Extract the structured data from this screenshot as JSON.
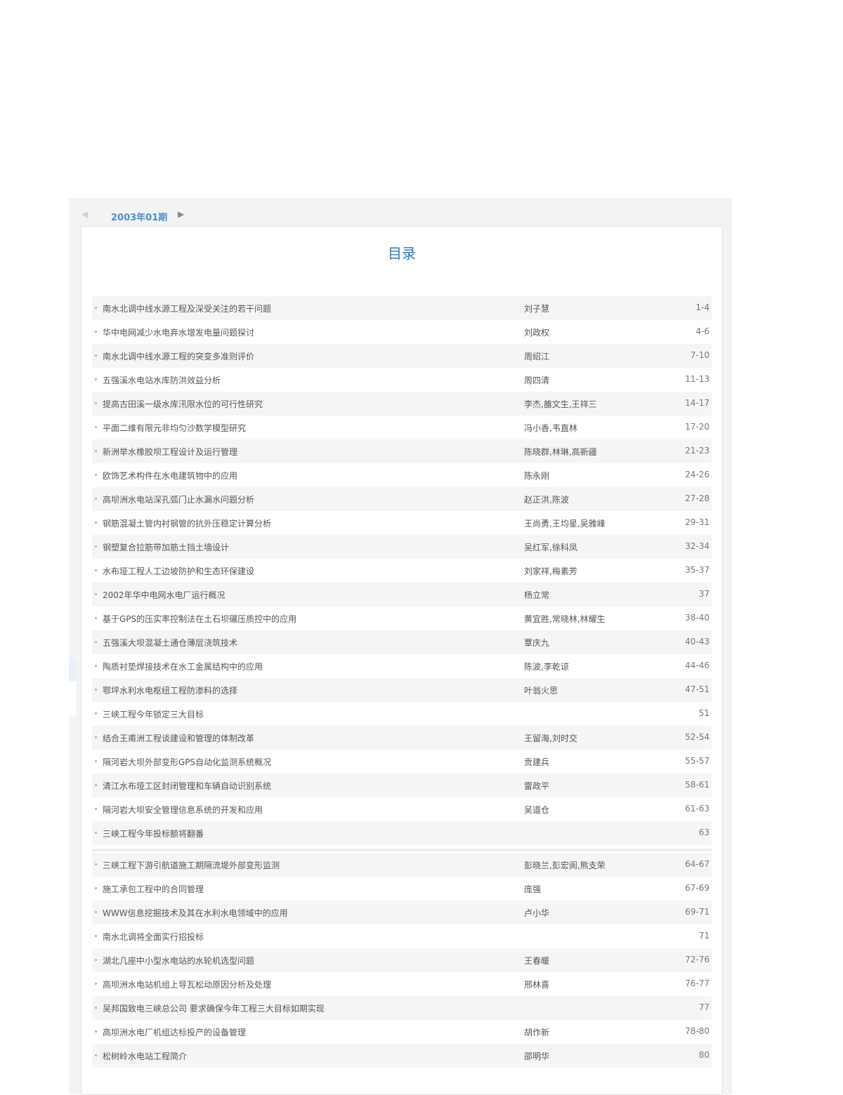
{
  "issue_nav": {
    "prev_icon": "◀",
    "issue_label": "2003年01期",
    "next_icon": "▶"
  },
  "toc": {
    "title": "目录",
    "articles_a": [
      {
        "title": "南水北调中线水源工程及深受关注的若干问题",
        "authors": "刘子慧",
        "pages": "1-4"
      },
      {
        "title": "华中电网减少水电弃水增发电量问题探讨",
        "authors": "刘政权",
        "pages": "4-6"
      },
      {
        "title": "南水北调中线水源工程的突变多准则评价",
        "authors": "周绍江",
        "pages": "7-10"
      },
      {
        "title": "五强溪水电站水库防洪效益分析",
        "authors": "周四清",
        "pages": "11-13"
      },
      {
        "title": "提高古田溪一级水库汛限水位的可行性研究",
        "authors": "李杰,雒文生,王祥三",
        "pages": "14-17"
      },
      {
        "title": "平面二维有限元非均匀沙数学模型研究",
        "authors": "冯小香,韦直林",
        "pages": "17-20"
      },
      {
        "title": "新洲举水橡胶坝工程设计及运行管理",
        "authors": "陈晓群,林琳,高新疆",
        "pages": "21-23"
      },
      {
        "title": "欧饰艺术构件在水电建筑物中的应用",
        "authors": "陈永刚",
        "pages": "24-26"
      },
      {
        "title": "高坝洲水电站深孔弧门止水漏水问题分析",
        "authors": "赵正洪,陈波",
        "pages": "27-28"
      },
      {
        "title": "钢筋混凝土管内衬钢管的抗外压稳定计算分析",
        "authors": "王尚勇,王均星,吴雅峰",
        "pages": "29-31"
      },
      {
        "title": "钢塑复合拉筋带加筋土挡土墙设计",
        "authors": "吴红军,徐科凤",
        "pages": "32-34"
      },
      {
        "title": "水布垭工程人工边坡防护和生态环保建设",
        "authors": "刘家祥,梅素芳",
        "pages": "35-37"
      },
      {
        "title": "2002年华中电网水电厂运行概况",
        "authors": "杨立常",
        "pages": "37"
      },
      {
        "title": "基于GPS的压实率控制法在土石坝碾压质控中的应用",
        "authors": "黄宜胜,常晓林,林耀生",
        "pages": "38-40"
      },
      {
        "title": "五强溪大坝混凝土通仓薄层浇筑技术",
        "authors": "覃庆九",
        "pages": "40-43"
      },
      {
        "title": "陶质衬垫焊接技术在水工金属结构中的应用",
        "authors": "陈波,李乾谅",
        "pages": "44-46"
      },
      {
        "title": "鄂坪水利水电枢纽工程防渗料的选择",
        "authors": "叶翁火思",
        "pages": "47-51"
      },
      {
        "title": "三峡工程今年锁定三大目标",
        "authors": "",
        "pages": "51"
      },
      {
        "title": "结合王甫洲工程谈建设和管理的体制改革",
        "authors": "王留海,刘时交",
        "pages": "52-54"
      },
      {
        "title": "隔河岩大坝外部变形GPS自动化监测系统概况",
        "authors": "贡建兵",
        "pages": "55-57"
      },
      {
        "title": "清江水布垭工区封闭管理和车辆自动识别系统",
        "authors": "雷政平",
        "pages": "58-61"
      },
      {
        "title": "隔河岩大坝安全管理信息系统的开发和应用",
        "authors": "吴道仓",
        "pages": "61-63"
      },
      {
        "title": "三峡工程今年投标额将翻番",
        "authors": "",
        "pages": "63"
      }
    ],
    "articles_b": [
      {
        "title": "三峡工程下游引航道施工期隔流堤外部变形监测",
        "authors": "彭晓兰,彭宏阆,熊支荣",
        "pages": "64-67"
      },
      {
        "title": "施工承包工程中的合同管理",
        "authors": "庞强",
        "pages": "67-69"
      },
      {
        "title": "WWW信息挖掘技术及其在水利水电领域中的应用",
        "authors": "卢小华",
        "pages": "69-71"
      },
      {
        "title": "南水北调将全面实行招投标",
        "authors": "",
        "pages": "71"
      },
      {
        "title": "湖北几座中小型水电站的水轮机选型问题",
        "authors": "王春暖",
        "pages": "72-76"
      },
      {
        "title": "高坝洲水电站机组上导瓦松动原因分析及处理",
        "authors": "邢林喜",
        "pages": "76-77"
      },
      {
        "title": "吴邦国致电三峡总公司 要求确保今年工程三大目标如期实现",
        "authors": "",
        "pages": "77"
      },
      {
        "title": "高坝洲水电厂机组达标投产的设备管理",
        "authors": "胡作新",
        "pages": "78-80"
      },
      {
        "title": "松树岭水电站工程简介",
        "authors": "邵明华",
        "pages": "80"
      }
    ]
  },
  "colors": {
    "accent": "#2a7ab8",
    "tab_underline": "#5b9bd5",
    "row_alt": "#f5f5f5"
  }
}
